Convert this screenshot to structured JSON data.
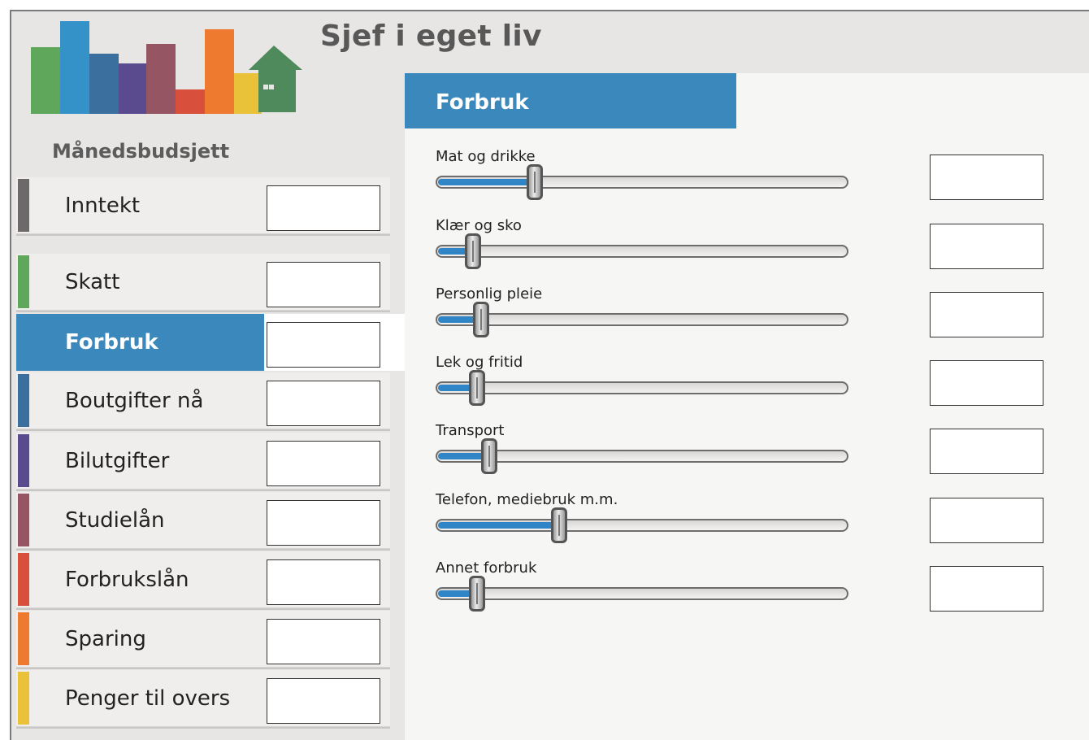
{
  "app": {
    "title": "Sjef i eget liv"
  },
  "logo": {
    "bar_colors": [
      "#5fa75a",
      "#3592c8",
      "#3a6f9e",
      "#5a4a8e",
      "#955563",
      "#d8503c",
      "#ee7a30",
      "#e9c23a"
    ],
    "house_color": "#4f8a5c"
  },
  "sidebar": {
    "title": "Månedsbudsjett",
    "items": [
      {
        "label": "Inntekt",
        "color": "#6d6869",
        "value": ""
      },
      {
        "label": "Skatt",
        "color": "#5fa75a",
        "value": ""
      },
      {
        "label": "Forbruk",
        "color": "#3b88bd",
        "value": "",
        "active": true
      },
      {
        "label": "Boutgifter nå",
        "color": "#3a6f9e",
        "value": ""
      },
      {
        "label": "Bilutgifter",
        "color": "#5a4a8e",
        "value": ""
      },
      {
        "label": "Studielån",
        "color": "#955563",
        "value": ""
      },
      {
        "label": "Forbrukslån",
        "color": "#d8503c",
        "value": ""
      },
      {
        "label": "Sparing",
        "color": "#ee7a30",
        "value": ""
      },
      {
        "label": "Penger til overs",
        "color": "#e9c23a",
        "value": ""
      }
    ]
  },
  "panel": {
    "title": "Forbruk",
    "sliders": [
      {
        "label": "Mat og drikke",
        "level": 0.24,
        "amount": ""
      },
      {
        "label": "Klær og sko",
        "level": 0.09,
        "amount": ""
      },
      {
        "label": "Personlig pleie",
        "level": 0.11,
        "amount": ""
      },
      {
        "label": "Lek og fritid",
        "level": 0.1,
        "amount": ""
      },
      {
        "label": "Transport",
        "level": 0.13,
        "amount": ""
      },
      {
        "label": "Telefon, mediebruk m.m.",
        "level": 0.3,
        "amount": ""
      },
      {
        "label": "Annet forbruk",
        "level": 0.1,
        "amount": ""
      }
    ]
  }
}
